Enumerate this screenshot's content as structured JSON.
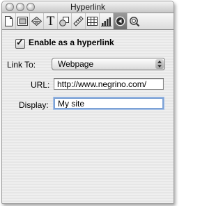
{
  "window": {
    "title": "Hyperlink"
  },
  "toolbar": {
    "tools": [
      {
        "icon": "document-icon"
      },
      {
        "icon": "page-layout-icon"
      },
      {
        "icon": "text-wrap-icon"
      },
      {
        "icon": "text-format-icon",
        "glyph": "T"
      },
      {
        "icon": "shapes-icon"
      },
      {
        "icon": "ruler-icon"
      },
      {
        "icon": "table-icon"
      },
      {
        "icon": "bar-chart-icon"
      },
      {
        "icon": "hyperlink-icon",
        "active": true
      },
      {
        "icon": "magnifier-icon"
      }
    ]
  },
  "form": {
    "enable_label": "Enable as a hyperlink",
    "enable_checked": true,
    "link_to_label": "Link To:",
    "link_to_value": "Webpage",
    "url_label": "URL:",
    "url_value": "http://www.negrino.com/",
    "display_label": "Display:",
    "display_value": "My site"
  }
}
